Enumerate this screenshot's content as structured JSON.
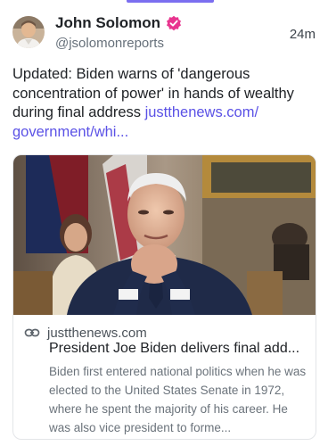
{
  "author": {
    "display_name": "John Solomon",
    "handle": "@jsolomonreports",
    "avatar_icon": "avatar-photo",
    "verified_icon": "verified-badge-icon",
    "verified_color": "#e8358f"
  },
  "timestamp": "24m",
  "post": {
    "text": "Updated: Biden warns of 'dangerous concentration of power' in hands of wealthy during final address ",
    "link_text": "justthenews.com/ government/whi..."
  },
  "link_card": {
    "domain": "justthenews.com",
    "title": "President Joe Biden delivers final add...",
    "description": "Biden first entered national politics when he was elected to the United States Senate in 1972, where he spent the majority of his career. He was also vice president to forme..."
  },
  "colors": {
    "accent": "#5b52e6",
    "tab_indicator": "#7b6ef0"
  }
}
